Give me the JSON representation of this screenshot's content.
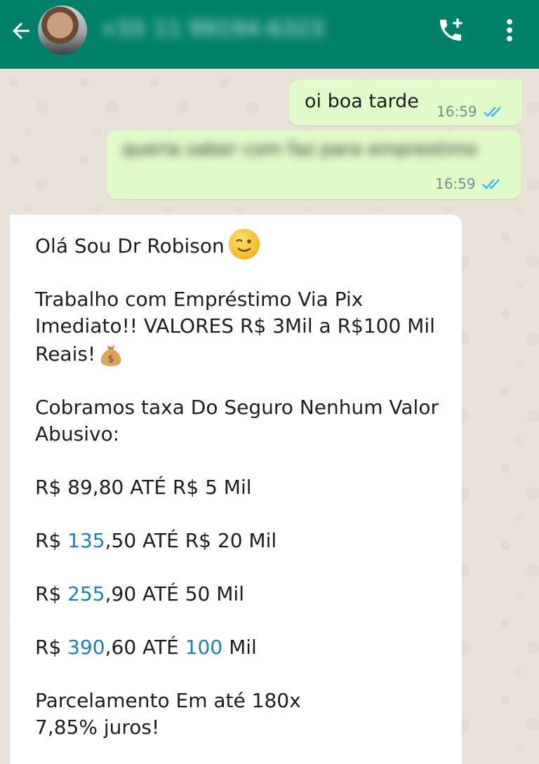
{
  "header": {
    "back_icon": "arrow-left-icon",
    "contact_number": "+55 11 99194-6323",
    "call_icon": "add-call-icon",
    "menu_icon": "more-vertical-icon",
    "color": "#00806a"
  },
  "messages": [
    {
      "direction": "outgoing",
      "text": "oi boa tarde",
      "time": "16:59",
      "status_icon": "double-check-read-icon"
    },
    {
      "direction": "outgoing",
      "text": "queria saber com faz para emprestimo",
      "blurred": true,
      "time": "16:59",
      "status_icon": "double-check-read-icon"
    },
    {
      "direction": "incoming",
      "lines": {
        "l1": "Olá Sou Dr Robison",
        "l1_emoji": "winking-face-emoji",
        "l2": "Trabalho com Empréstimo Via Pix",
        "l3": "Imediato!! VALORES R$ 3Mil a R$100 Mil",
        "l4": "Reais!",
        "l4_emoji": "money-bag-emoji",
        "l5": "Cobramos taxa Do Seguro Nenhum Valor",
        "l6": "Abusivo:",
        "t1": "R$ 89,80 ATÉ R$ 5 Mil",
        "t2_a": "R$ ",
        "t2_b": "135",
        "t2_c": ",50 ATÉ R$ 20 Mil",
        "t3_a": "R$ ",
        "t3_b": "255",
        "t3_c": ",90 ATÉ 50 Mil",
        "t4_a": "R$ ",
        "t4_b": "390",
        "t4_c": ",60 ATÉ ",
        "t4_d": "100",
        "t4_e": " Mil",
        "p1": "Parcelamento Em até 180x",
        "p2": "7,85% juros!"
      }
    }
  ],
  "colors": {
    "outgoing_bubble": "#e2fbcb",
    "incoming_bubble": "#ffffff",
    "link_number": "#1f7fb6",
    "read_check": "#34b7f1"
  }
}
